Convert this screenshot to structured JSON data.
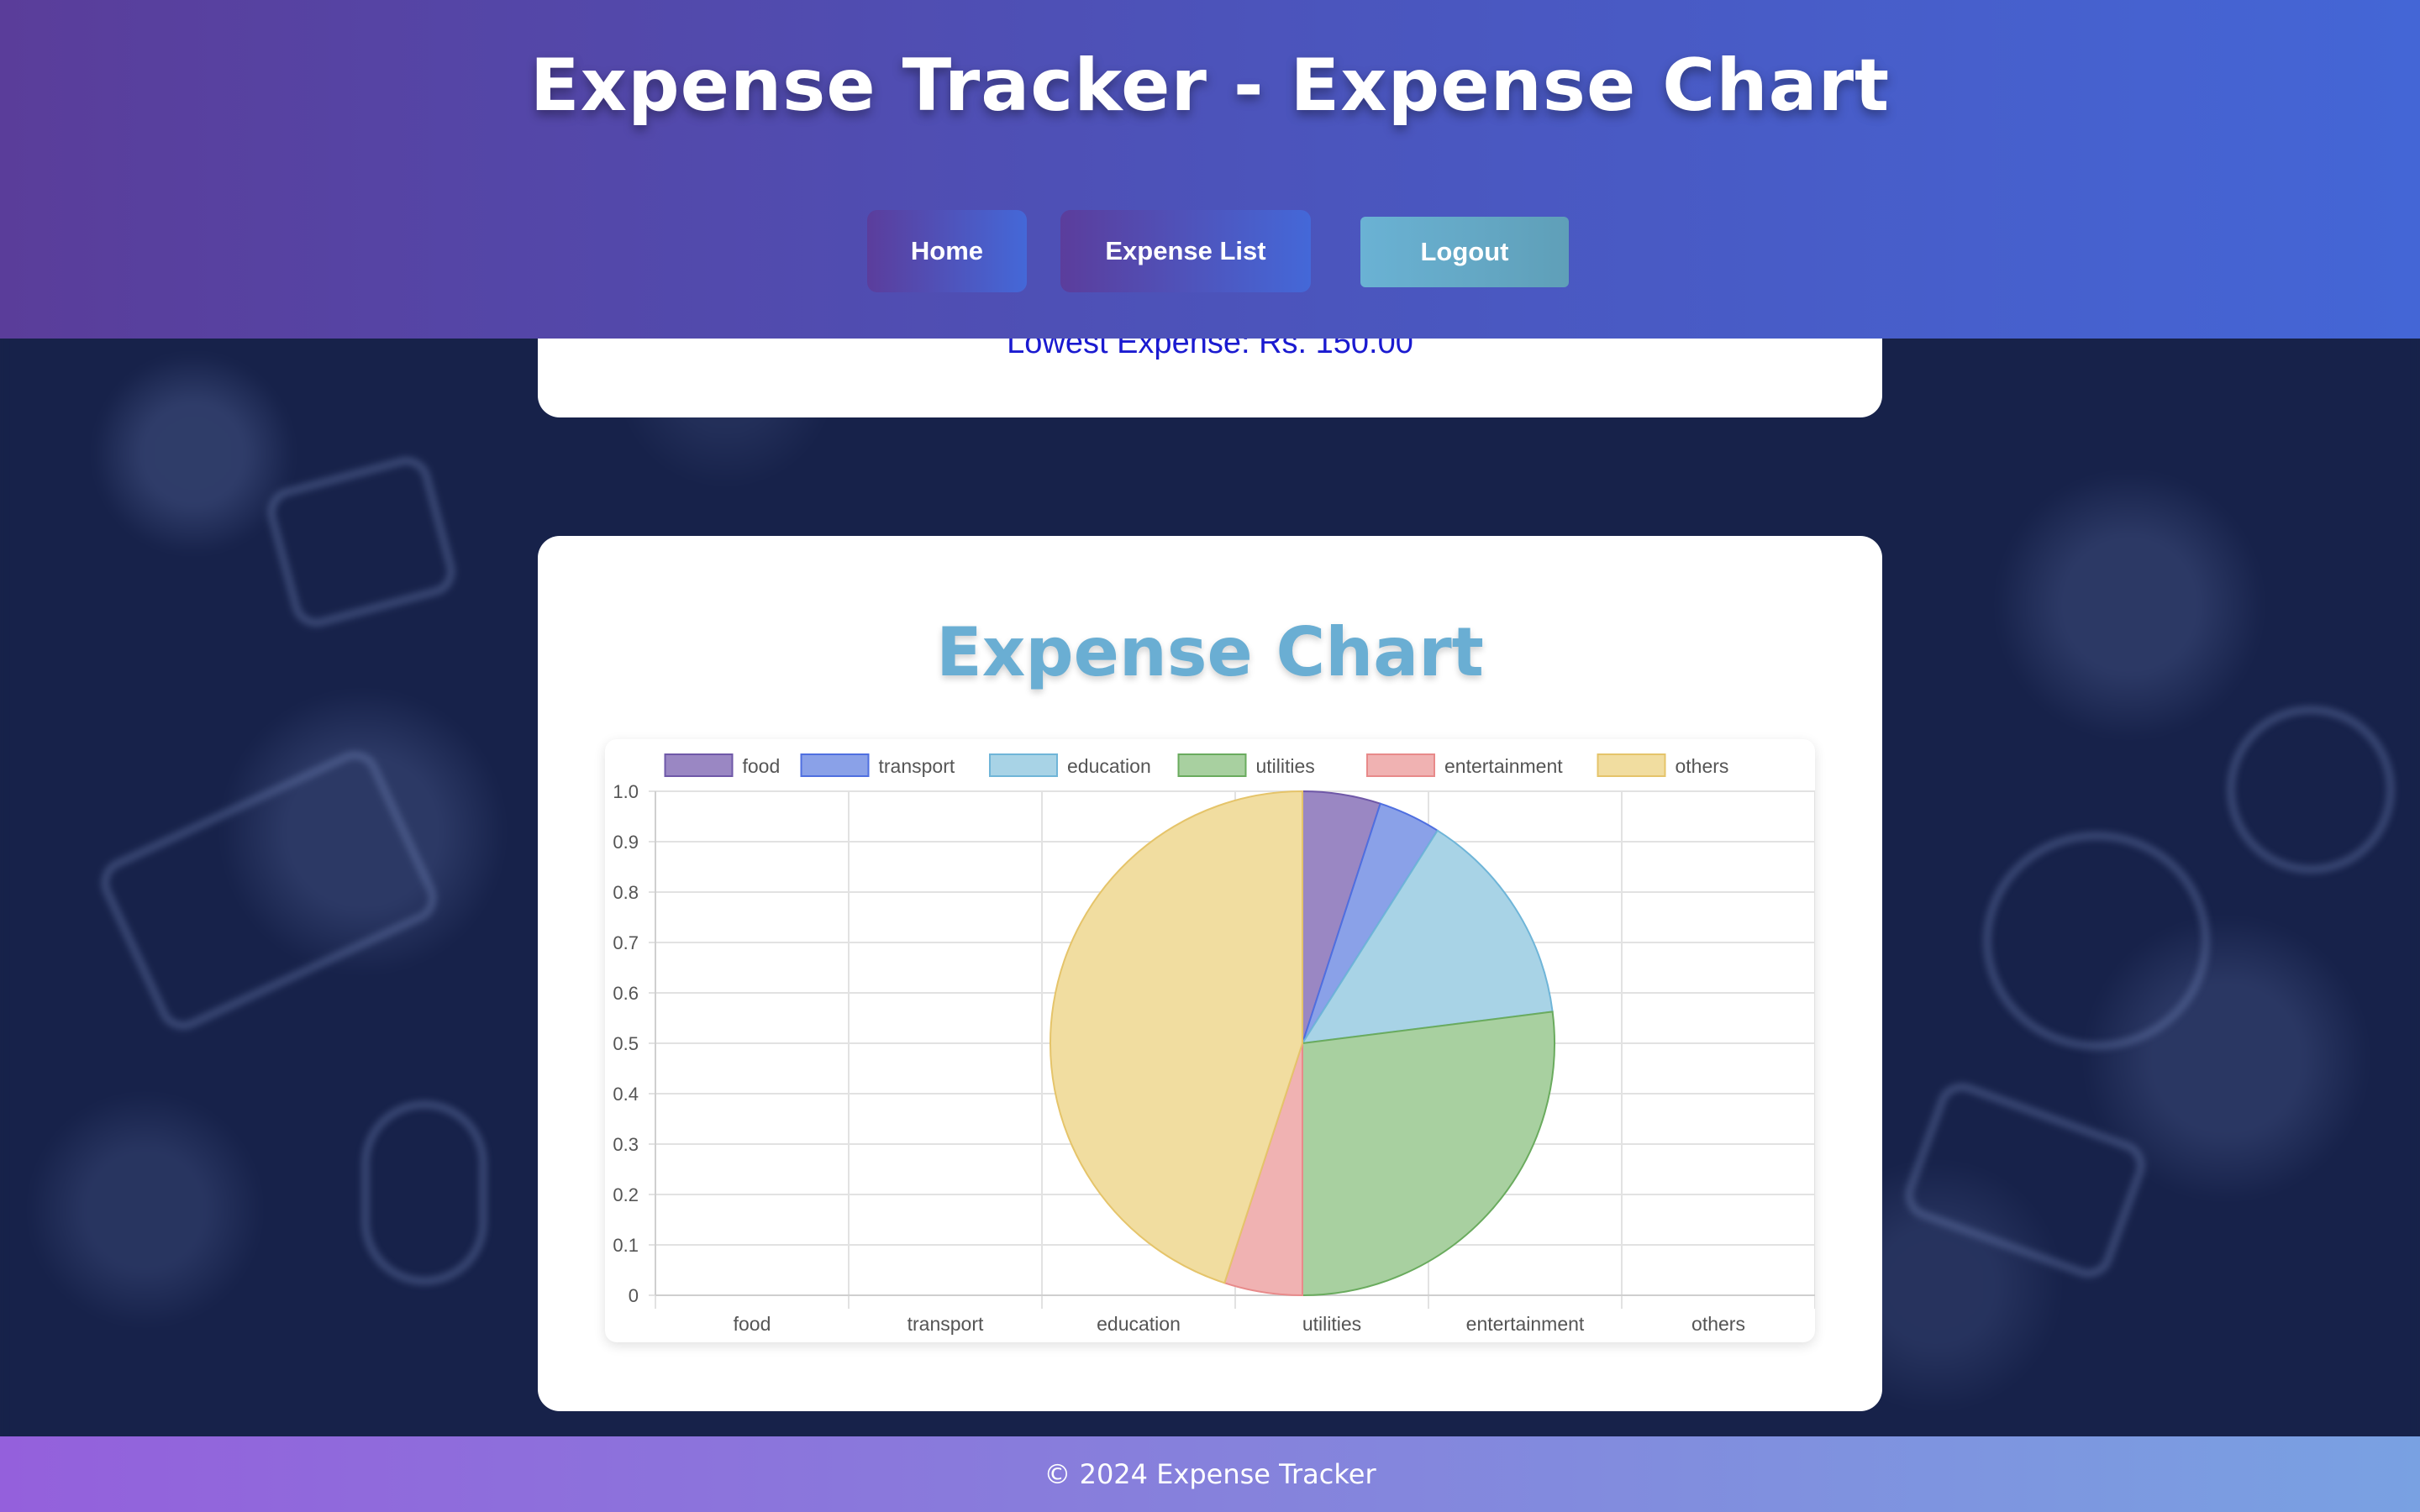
{
  "header": {
    "title": "Expense Tracker - Expense Chart",
    "nav": {
      "home": "Home",
      "expense_list": "Expense List",
      "logout": "Logout"
    }
  },
  "summary": {
    "lowest_expense": "Lowest Expense: Rs. 150.00"
  },
  "chart_section": {
    "heading": "Expense Chart"
  },
  "chart_data": {
    "type": "pie",
    "categories": [
      "food",
      "transport",
      "education",
      "utilities",
      "entertainment",
      "others"
    ],
    "values": [
      0.05,
      0.04,
      0.14,
      0.27,
      0.05,
      0.45
    ],
    "legend": "top",
    "grid": true,
    "ylim": [
      0,
      1.0
    ],
    "yticks": [
      "1.0",
      "0.9",
      "0.8",
      "0.7",
      "0.6",
      "0.5",
      "0.4",
      "0.3",
      "0.2",
      "0.1",
      "0"
    ],
    "colors": [
      "#9a87c3",
      "#8aa1e8",
      "#a8d3e6",
      "#a8d0a0",
      "#f0b2b2",
      "#f1dda0"
    ],
    "strokes": [
      "#6f58a8",
      "#4f6fe0",
      "#6fb5d8",
      "#6aab5e",
      "#e88a8a",
      "#e5c46a"
    ]
  },
  "footer": {
    "text": "© 2024 Expense Tracker"
  }
}
